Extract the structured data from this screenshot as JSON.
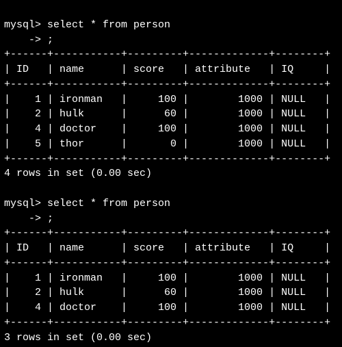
{
  "queries": [
    {
      "prompt": "mysql>",
      "cont_prompt": "    ->",
      "statement_part1": " select * from person",
      "statement_part2": " ;",
      "columns": [
        "ID",
        "name",
        "score",
        "attribute",
        "IQ"
      ],
      "rows": [
        {
          "ID": 1,
          "name": "ironman",
          "score": 100,
          "attribute": 1000,
          "IQ": "NULL"
        },
        {
          "ID": 2,
          "name": "hulk",
          "score": 60,
          "attribute": 1000,
          "IQ": "NULL"
        },
        {
          "ID": 4,
          "name": "doctor",
          "score": 100,
          "attribute": 1000,
          "IQ": "NULL"
        },
        {
          "ID": 5,
          "name": "thor",
          "score": 0,
          "attribute": 1000,
          "IQ": "NULL"
        }
      ],
      "summary": "4 rows in set (0.00 sec)"
    },
    {
      "prompt": "mysql>",
      "cont_prompt": "    ->",
      "statement_part1": " select * from person",
      "statement_part2": " ;",
      "columns": [
        "ID",
        "name",
        "score",
        "attribute",
        "IQ"
      ],
      "rows": [
        {
          "ID": 1,
          "name": "ironman",
          "score": 100,
          "attribute": 1000,
          "IQ": "NULL"
        },
        {
          "ID": 2,
          "name": "hulk",
          "score": 60,
          "attribute": 1000,
          "IQ": "NULL"
        },
        {
          "ID": 4,
          "name": "doctor",
          "score": 100,
          "attribute": 1000,
          "IQ": "NULL"
        }
      ],
      "summary": "3 rows in set (0.00 sec)"
    }
  ],
  "col_widths": {
    "ID": 4,
    "name": 9,
    "score": 7,
    "attribute": 11,
    "IQ": 6
  }
}
